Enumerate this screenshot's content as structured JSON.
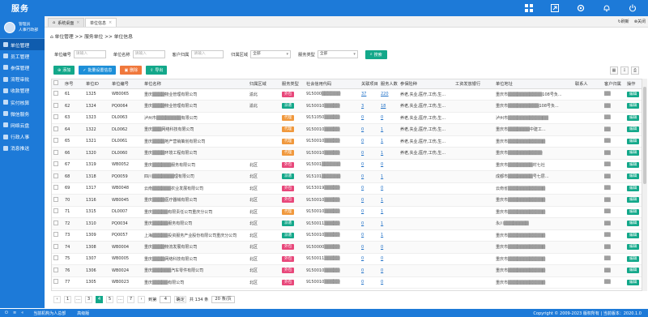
{
  "header": {
    "logo": "服务",
    "icons": [
      "grid-icon",
      "export-icon",
      "settings-icon",
      "bell-icon",
      "power-icon"
    ]
  },
  "user": {
    "line1": "管理员",
    "line2": "人事行政部"
  },
  "sidebar": {
    "items": [
      {
        "label": "单位管理",
        "active": true
      },
      {
        "label": "员工管理"
      },
      {
        "label": "参保管理"
      },
      {
        "label": "流程审批"
      },
      {
        "label": "收款管理"
      },
      {
        "label": "实付核算"
      },
      {
        "label": "微信服务"
      },
      {
        "label": "网络云盘"
      },
      {
        "label": "行政人事"
      },
      {
        "label": "消息推送"
      }
    ]
  },
  "tabs": [
    {
      "label": "系统桌面"
    },
    {
      "label": "单位信息"
    }
  ],
  "tabbar": {
    "refresh": "刷新",
    "close": "关闭"
  },
  "breadcrumb": "单位管理 >> 服务单位 >> 单位信息",
  "filters": {
    "fields": [
      {
        "label": "单位编号",
        "placeholder": "请输入"
      },
      {
        "label": "单位名称",
        "placeholder": "请输入"
      },
      {
        "label": "客户归属",
        "placeholder": "请输入"
      }
    ],
    "selects": [
      {
        "label": "归属区域",
        "value": "全部"
      },
      {
        "label": "服务类型",
        "value": "全部"
      }
    ],
    "search_label": "搜索"
  },
  "actions": [
    {
      "label": "添加",
      "color": "#13a88a"
    },
    {
      "label": "批量设置信息",
      "color": "#1d8fd8"
    },
    {
      "label": "删除",
      "color": "#f0783c"
    },
    {
      "label": "导出",
      "color": "#13a88a"
    }
  ],
  "table": {
    "columns": [
      "",
      "序号",
      "单位ID",
      "单位编号",
      "单位名称",
      "归属区域",
      "服务类型",
      "社会信用代码",
      "关联项目",
      "服务人数",
      "参保险种",
      "工资发放银行",
      "单位地址",
      "联系人",
      "客户归属",
      "操作"
    ],
    "rows": [
      [
        "61",
        "1325",
        "WB0065",
        "重庆▒▒▒▒物业管理有限公司",
        "渝北",
        "外包",
        "915000▒▒▒▒▒▒",
        "37",
        "220",
        "养老,失业,医疗,工伤,生...",
        "",
        "重庆市▒▒▒▒▒▒▒▒▒▒▒108号负...",
        "",
        "▒▒",
        "编辑"
      ],
      [
        "62",
        "1324",
        "PQ0064",
        "重庆▒▒▒▒物业管理有限公司",
        "渝北",
        "派遣",
        "9150010▒▒▒▒▒",
        "3",
        "18",
        "养老,失业,医疗,工伤,生...",
        "",
        "重庆市▒▒▒▒▒▒▒▒▒▒108号负...",
        "",
        "▒▒",
        "编辑"
      ],
      [
        "63",
        "1323",
        "DL0063",
        "泸州市▒▒▒▒▒▒▒▒有限公司",
        "",
        "代理",
        "9151050▒▒▒▒▒",
        "0",
        "0",
        "养老,失业,医疗,工伤,生...",
        "",
        "泸州市▒▒▒▒▒▒▒▒▒▒▒▒▒",
        "",
        "▒▒",
        "编辑"
      ],
      [
        "64",
        "1322",
        "DL0062",
        "重庆▒▒▒网络科技有限公司",
        "",
        "代理",
        "9150010▒▒▒▒▒",
        "0",
        "1",
        "养老,失业,医疗,工伤,生...",
        "",
        "重庆市▒▒▒▒▒▒▒中建工...",
        "",
        "▒▒",
        "编辑"
      ],
      [
        "65",
        "1321",
        "DL0061",
        "重庆▒▒▒▒地产营销策划有限公司",
        "",
        "代理",
        "9150010▒▒▒▒▒",
        "0",
        "1",
        "养老,失业,医疗,工伤,生...",
        "",
        "重庆市▒▒▒▒▒▒▒▒▒▒▒▒",
        "",
        "▒▒",
        "编辑"
      ],
      [
        "66",
        "1320",
        "DL0060",
        "重庆▒▒▒▒环境工程有限公司",
        "",
        "代理",
        "9150010▒▒▒▒▒",
        "0",
        "1",
        "养老,失业,医疗,工伤,生...",
        "",
        "重庆市▒▒▒▒▒▒▒▒▒▒▒",
        "",
        "▒▒",
        "编辑"
      ],
      [
        "67",
        "1319",
        "WB0052",
        "重庆▒▒▒▒▒▒服务有限公司",
        "北区",
        "外包",
        "915001▒▒▒▒▒▒",
        "0",
        "0",
        "",
        "",
        "重庆市▒▒▒▒▒▒▒▒村七社",
        "",
        "▒▒",
        "编辑"
      ],
      [
        "68",
        "1318",
        "PQ0059",
        "四川▒▒▒▒▒▒▒理有限公司",
        "北区",
        "派遣",
        "915101▒▒▒▒▒▒",
        "0",
        "1",
        "",
        "",
        "成都市▒▒▒▒▒▒▒▒号七层...",
        "",
        "▒▒",
        "编辑"
      ],
      [
        "69",
        "1317",
        "WB0048",
        "云南▒▒▒▒▒▒农业发展有限公司",
        "北区",
        "外包",
        "9153019▒▒▒▒▒",
        "0",
        "0",
        "",
        "",
        "云南省▒▒▒▒▒▒▒▒▒▒▒▒",
        "",
        "▒▒",
        "编辑"
      ],
      [
        "70",
        "1316",
        "WB0045",
        "重庆▒▒▒▒医疗器械有限公司",
        "北区",
        "外包",
        "9150010▒▒▒▒▒",
        "0",
        "1",
        "",
        "",
        "重庆市▒▒▒▒▒▒▒▒▒▒▒▒",
        "",
        "▒▒",
        "编辑"
      ],
      [
        "71",
        "1315",
        "DL0007",
        "重庆▒▒▒▒▒有限责任公司重庆分公司",
        "北区",
        "代理",
        "9150010▒▒▒▒▒",
        "0",
        "1",
        "",
        "",
        "重庆市▒▒▒▒▒▒▒▒▒▒▒▒",
        "",
        "▒▒",
        "编辑"
      ],
      [
        "72",
        "1310",
        "PQ0034",
        "重庆▒▒▒▒▒服务有限公司",
        "北区",
        "派遣",
        "9150011▒▒▒▒▒",
        "0",
        "1",
        "",
        "",
        "永川▒▒▒▒▒▒▒▒",
        "",
        "▒▒",
        "编辑"
      ],
      [
        "73",
        "1309",
        "PQ0057",
        "上海▒▒▒▒▒投资服务产业股份有限公司重庆分公司",
        "北区",
        "派遣",
        "9150010▒▒▒▒▒",
        "0",
        "1",
        "",
        "",
        "重庆市▒▒▒▒▒▒▒▒▒▒▒▒",
        "",
        "▒▒",
        "编辑"
      ],
      [
        "74",
        "1308",
        "WB0004",
        "重庆▒▒▒▒物流发展有限公司",
        "北区",
        "外包",
        "9150000▒▒▒▒▒",
        "0",
        "0",
        "",
        "",
        "重庆市▒▒▒▒▒▒▒▒▒▒▒▒",
        "",
        "▒▒",
        "编辑"
      ],
      [
        "75",
        "1307",
        "WB0005",
        "重庆▒▒▒▒网络科技有限公司",
        "北区",
        "外包",
        "9150011▒▒▒▒▒",
        "0",
        "0",
        "",
        "",
        "重庆市▒▒▒▒▒▒▒▒▒▒▒▒",
        "",
        "▒▒",
        "编辑"
      ],
      [
        "76",
        "1306",
        "WB0024",
        "重庆▒▒▒▒▒▒汽车零件有限公司",
        "北区",
        "外包",
        "9150010▒▒▒▒▒",
        "0",
        "0",
        "",
        "",
        "重庆市▒▒▒▒▒▒▒▒▒▒▒▒",
        "",
        "▒▒",
        "编辑"
      ],
      [
        "77",
        "1305",
        "WB0023",
        "重庆▒▒▒▒▒有限公司",
        "北区",
        "外包",
        "9150010▒▒▒▒▒",
        "0",
        "0",
        "",
        "",
        "重庆市▒▒▒▒▒▒▒▒▒▒▒▒",
        "",
        "▒▒",
        "编辑"
      ]
    ]
  },
  "badge_colors": {
    "外包": "#e8477a",
    "派遣": "#13a88a",
    "代理": "#f0983c"
  },
  "pager": {
    "prev": "‹",
    "pages": [
      "1",
      "...",
      "3",
      "4",
      "5",
      "...",
      "7"
    ],
    "current": "4",
    "next": "›",
    "goto_label": "到第",
    "goto_value": "4",
    "confirm": "确定",
    "total": "共 134 条",
    "page_size": "20 条/页"
  },
  "statusbar": {
    "left1": "当前机构为人总部",
    "left2": "高级版",
    "right": "Copyright © 2009-2023 版权所有 | 当前版本：2020.1.0"
  }
}
